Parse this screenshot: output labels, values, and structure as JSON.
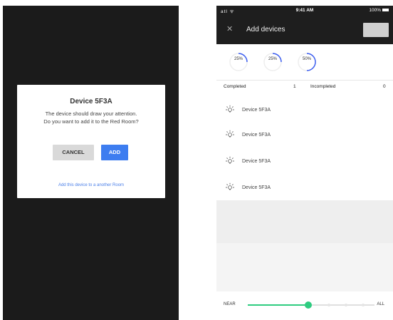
{
  "dialog": {
    "title": "Device 5F3A",
    "message_line1": "The device should draw your attention.",
    "message_line2": "Do you want to add it to the Red Room?",
    "cancel_label": "CANCEL",
    "add_label": "ADD",
    "link_label": "Add this device to a another Room"
  },
  "statusbar": {
    "signal": "atl ᯤ",
    "time": "9:41 AM",
    "battery": "100%"
  },
  "appbar": {
    "close_icon": "close-icon",
    "title": "Add devices"
  },
  "progress_rings": [
    {
      "label": "25%",
      "value": 0.25
    },
    {
      "label": "25%",
      "value": 0.25
    },
    {
      "label": "50%",
      "value": 0.5
    }
  ],
  "stats": {
    "completed_label": "Completed",
    "completed_value": "1",
    "incompleted_label": "Incompleted",
    "incompleted_value": "0"
  },
  "devices": [
    {
      "icon": "bulb-icon",
      "label": "Device 5F3A"
    },
    {
      "icon": "bulb-icon",
      "label": "Device 5F3A"
    },
    {
      "icon": "bulb-icon",
      "label": "Device 5F3A"
    },
    {
      "icon": "bulb-icon",
      "label": "Device 5F3A"
    }
  ],
  "range_slider": {
    "left_label": "NEAR",
    "right_label": "ALL",
    "value": 0.48
  },
  "colors": {
    "dialog_add": "#3d7df0",
    "link": "#4a7fe8",
    "ring_accent": "#3d5ff0",
    "slider_accent": "#2ecc80",
    "dark_bg": "#1b1b1b"
  }
}
